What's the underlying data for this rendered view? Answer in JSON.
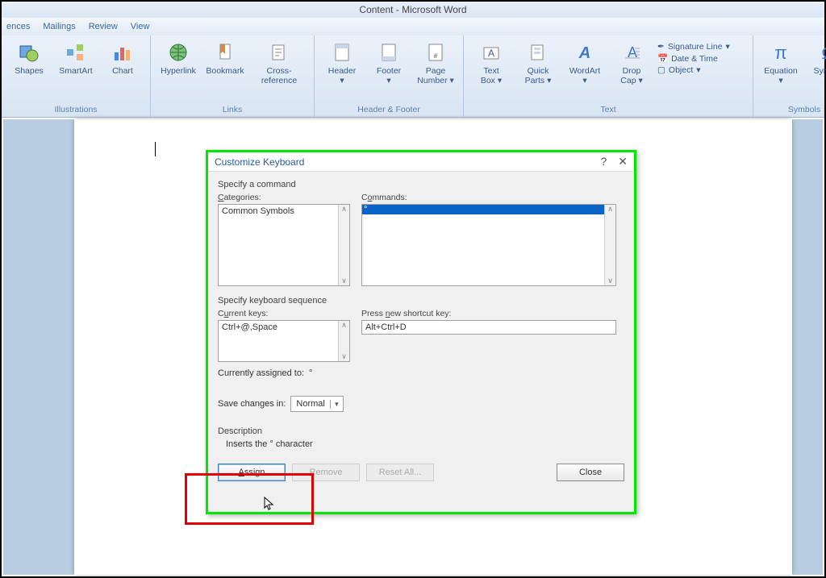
{
  "title": "Content - Microsoft Word",
  "tabs": {
    "references": "ences",
    "mailings": "Mailings",
    "review": "Review",
    "view": "View"
  },
  "ribbon": {
    "illustrations": {
      "shapes": "Shapes",
      "smartart": "SmartArt",
      "chart": "Chart",
      "title": "Illustrations"
    },
    "links": {
      "hyperlink": "Hyperlink",
      "bookmark": "Bookmark",
      "xref": "Cross-reference",
      "title": "Links"
    },
    "hf": {
      "header": "Header",
      "footer": "Footer",
      "pagenum": "Page\nNumber",
      "title": "Header & Footer"
    },
    "text": {
      "textbox": "Text\nBox",
      "quick": "Quick\nParts",
      "wordart": "WordArt",
      "dropcap": "Drop\nCap",
      "sig": "Signature Line",
      "dt": "Date & Time",
      "obj": "Object",
      "title": "Text"
    },
    "symbols": {
      "eq": "Equation",
      "sym": "Symbol",
      "title": "Symbols"
    }
  },
  "dialog": {
    "title": "Customize Keyboard",
    "spec_cmd": "Specify a command",
    "categories_lbl": "Categories:",
    "categories_item": "Common Symbols",
    "commands_lbl": "Commands:",
    "commands_sel": "°",
    "spec_seq": "Specify keyboard sequence",
    "current_lbl": "Current keys:",
    "current_val": "Ctrl+@,Space",
    "press_lbl_pre": "Press ",
    "press_lbl_ul": "n",
    "press_lbl_post": "ew shortcut key:",
    "press_val": "Alt+Ctrl+D",
    "assigned_lbl": "Currently assigned to:",
    "assigned_val": "°",
    "save_lbl_pre": "Sa",
    "save_lbl_ul": "v",
    "save_lbl_post": "e changes in:",
    "save_val": "Normal",
    "desc_lbl": "Description",
    "desc_val": "Inserts the ° character",
    "btn_assign_ul": "A",
    "btn_assign_post": "ssign",
    "btn_remove": "Remove",
    "btn_reset": "Reset All...",
    "btn_close": "Close"
  }
}
